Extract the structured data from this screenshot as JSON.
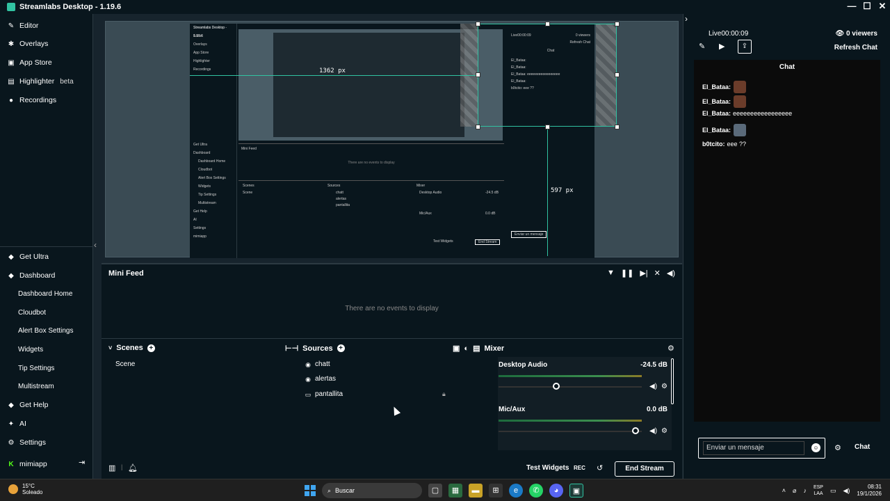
{
  "app": {
    "title": "Streamlabs Desktop - 1.19.6"
  },
  "window_controls": {
    "minimize": "—",
    "maximize": "☐",
    "close": "✕"
  },
  "sidebar": {
    "top_items": [
      {
        "label": "Editor",
        "icon": "pencil-icon"
      },
      {
        "label": "Overlays",
        "icon": "overlays-icon"
      },
      {
        "label": "App Store",
        "icon": "store-icon"
      },
      {
        "label": "Highlighter",
        "badge": "beta",
        "icon": "highlighter-icon"
      },
      {
        "label": "Recordings",
        "icon": "record-icon"
      }
    ],
    "bottom_items": {
      "get_ultra": "Get Ultra",
      "dashboard": "Dashboard",
      "dashboard_home": "Dashboard Home",
      "cloudbot": "Cloudbot",
      "alert_box_settings": "Alert Box Settings",
      "widgets": "Widgets",
      "tip_settings": "Tip Settings",
      "multistream": "Multistream",
      "get_help": "Get Help",
      "ai": "AI",
      "settings": "Settings",
      "account": "mimiapp"
    }
  },
  "preview": {
    "width_label": "1362 px",
    "height_label": "597 px"
  },
  "mini_feed": {
    "title": "Mini Feed",
    "empty_text": "There are no events to display"
  },
  "scenes": {
    "title": "Scenes",
    "items": [
      "Scene"
    ]
  },
  "sources": {
    "title": "Sources",
    "items": [
      {
        "name": "chatt",
        "icon": "globe-icon"
      },
      {
        "name": "alertas",
        "icon": "globe-icon"
      },
      {
        "name": "pantallita",
        "icon": "monitor-icon"
      }
    ]
  },
  "mixer": {
    "title": "Mixer",
    "channels": [
      {
        "name": "Desktop Audio",
        "level": "-24.5 dB",
        "volume_fraction": 0.4
      },
      {
        "name": "Mic/Aux",
        "level": "0.0 dB",
        "volume_fraction": 0.95
      }
    ]
  },
  "footer": {
    "test_widgets": "Test Widgets",
    "rec": "REC",
    "end_stream": "End Stream"
  },
  "chat": {
    "live_status": "Live00:00:09",
    "viewers": "0 viewers",
    "refresh": "Refresh Chat",
    "title": "Chat",
    "messages": [
      {
        "user": "El_Bataa:",
        "text": "",
        "emote": true
      },
      {
        "user": "El_Bataa:",
        "text": "",
        "emote": true
      },
      {
        "user": "El_Bataa:",
        "text": "eeeeeeeeeeeeeeeee",
        "emote": false
      },
      {
        "user": "El_Bataa:",
        "text": "",
        "emote": true
      },
      {
        "user": "b0tcito:",
        "text": "eee ??",
        "emote": false
      }
    ],
    "input_placeholder": "Enviar un mensaje",
    "send_label": "Chat"
  },
  "taskbar": {
    "temperature": "15°C",
    "weather": "Soleado",
    "search_placeholder": "Buscar",
    "lang_top": "ESP",
    "lang_bottom": "LAA",
    "time": "08:31",
    "date": "19/1/2026"
  },
  "colors": {
    "accent": "#31c3a2",
    "background": "#09161d",
    "preview_bg": "#17242d"
  }
}
